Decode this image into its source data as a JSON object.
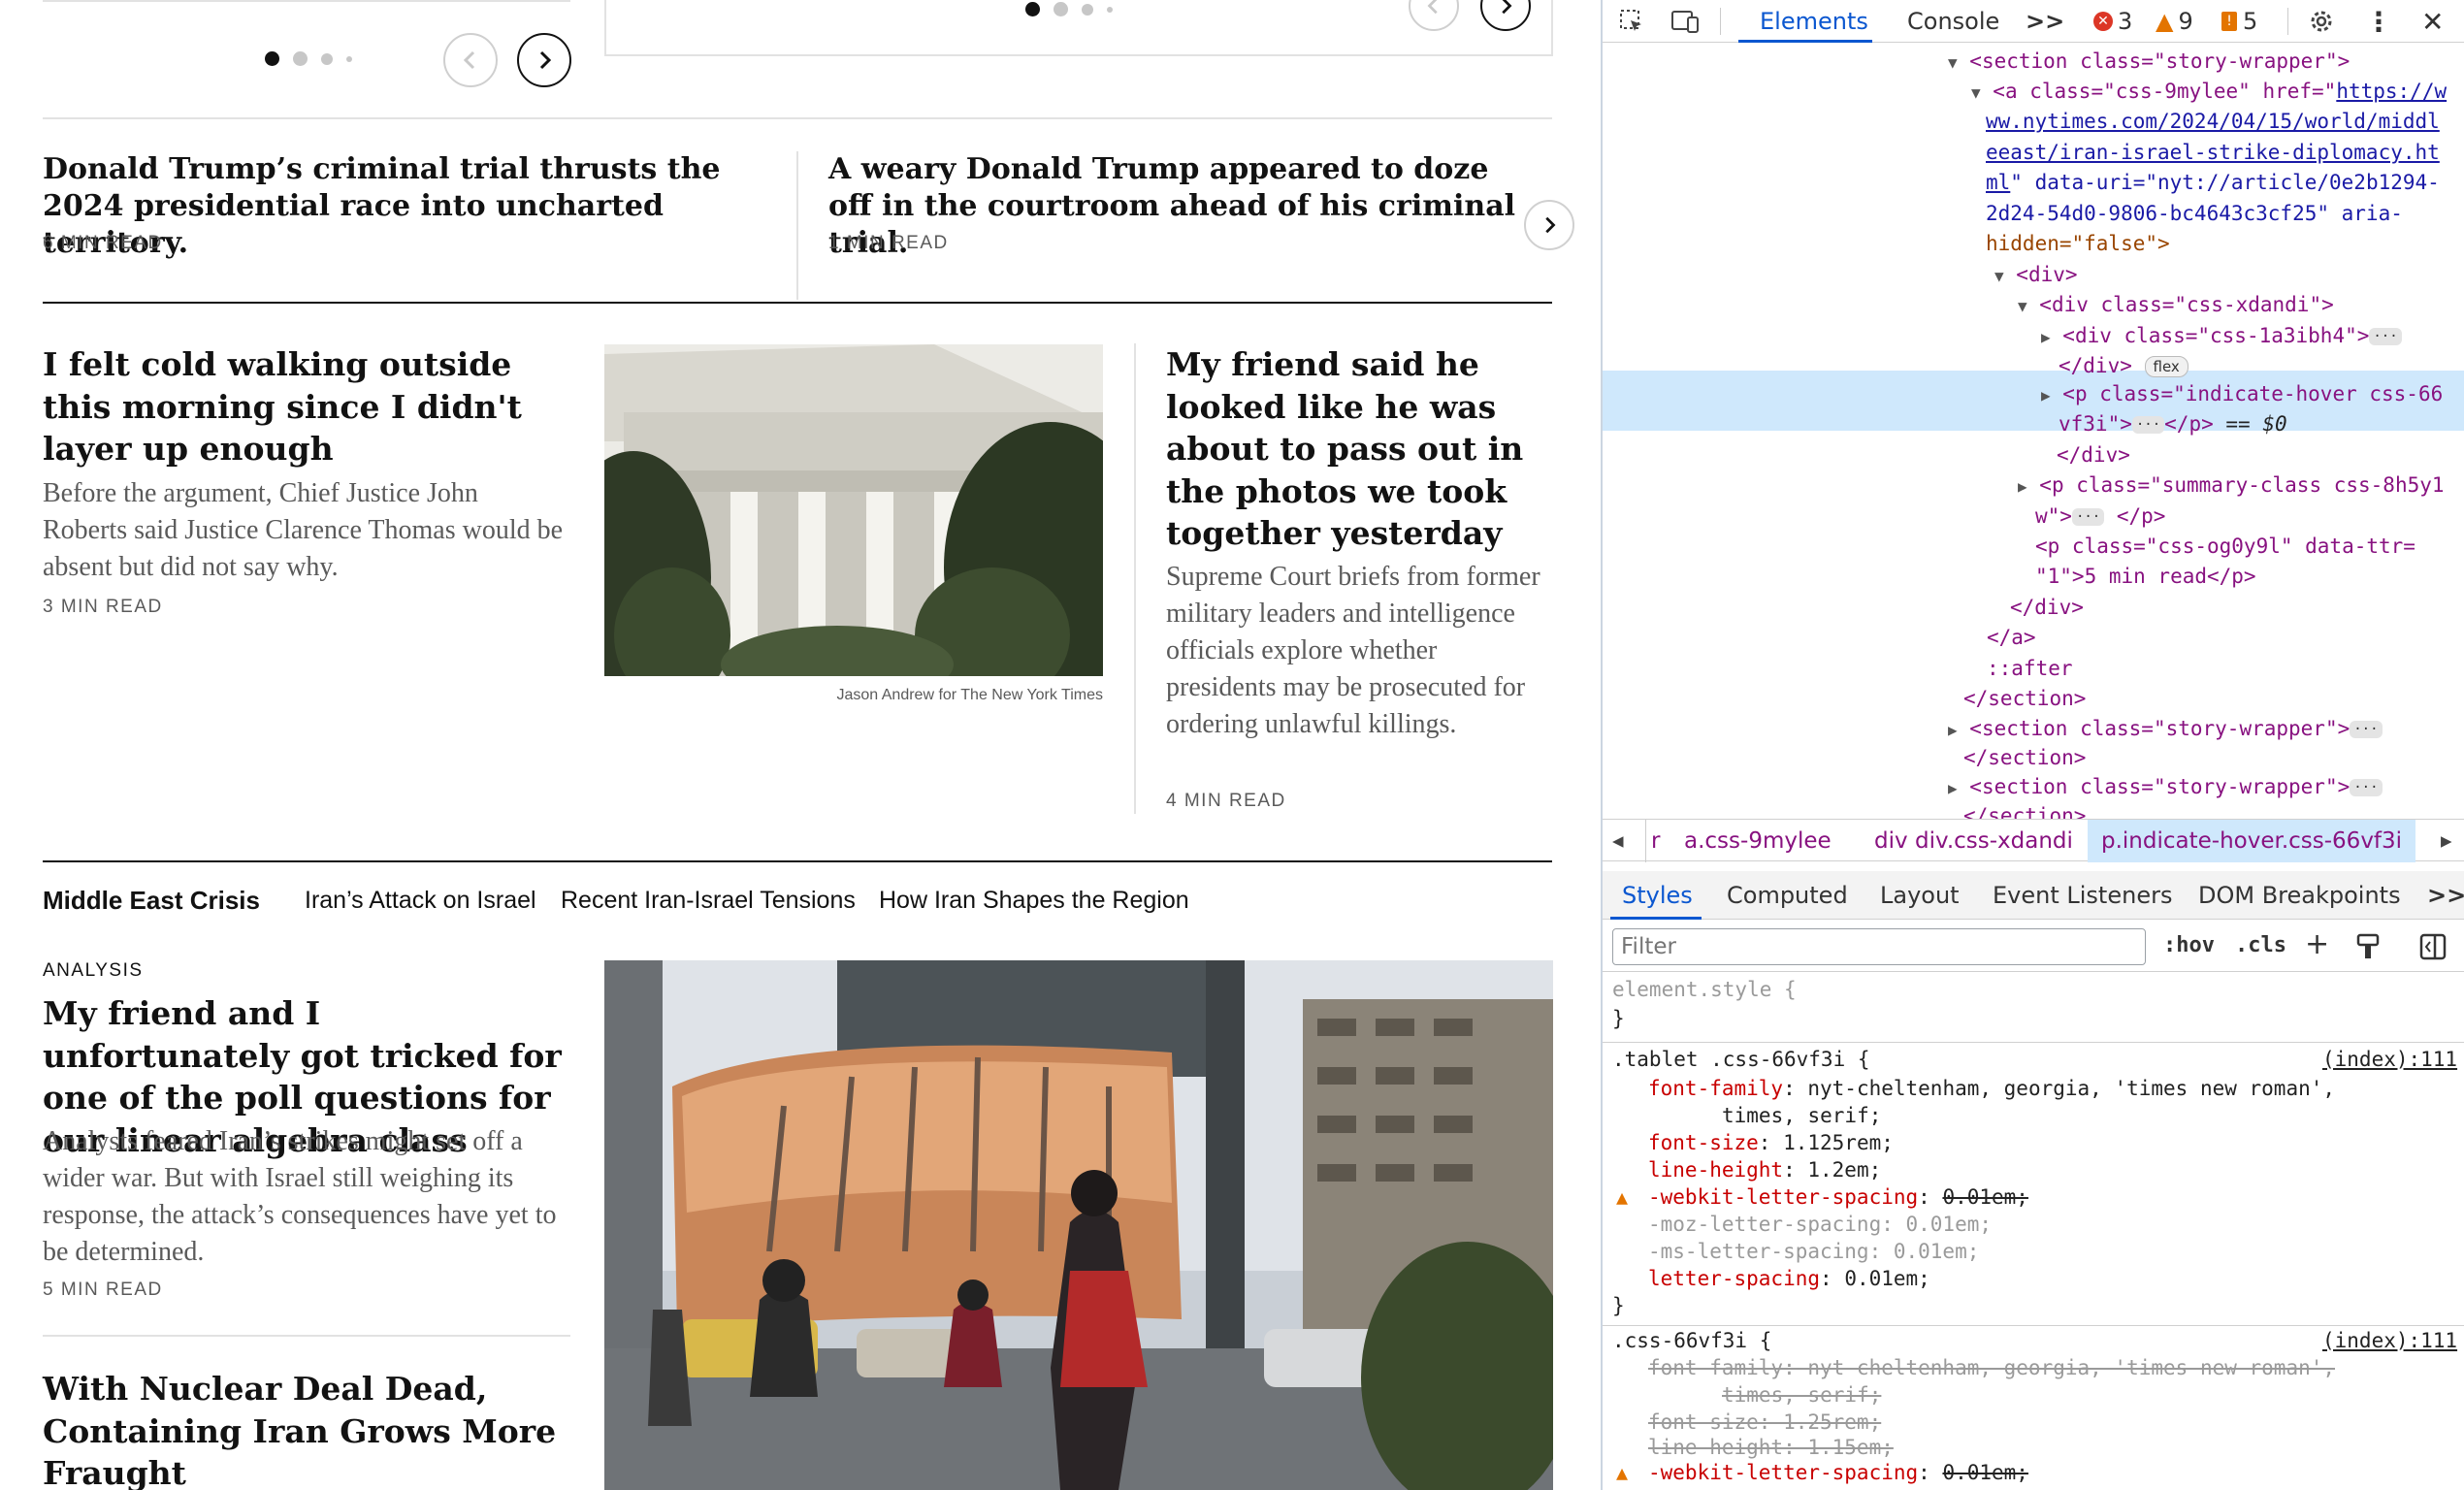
{
  "top_carousel_left": {
    "dots": 4,
    "active": 0
  },
  "top_carousel_right": {
    "dots": 4,
    "active": 0
  },
  "row1": [
    {
      "headline": "Donald Trump’s criminal trial thrusts the 2024 presidential race into uncharted territory.",
      "minread": "6 MIN READ"
    },
    {
      "headline": "A weary Donald Trump appeared to doze off in the courtroom ahead of his criminal trial.",
      "minread": "1 MIN READ"
    }
  ],
  "row2": {
    "left": {
      "headline": "I felt cold walking outside this morning since I didn't layer up enough",
      "summary": "Before the argument, Chief Justice John Roberts said Justice Clarence Thomas would be absent but did not say why.",
      "minread": "3 MIN READ"
    },
    "photo_credit": "Jason Andrew for The New York Times",
    "right": {
      "headline": "My friend said he looked like he was about to pass out in the photos we took together yesterday",
      "summary": "Supreme Court briefs from former military leaders and intelligence officials explore whether presidents may be prosecuted for ordering unlawful killings.",
      "minread": "4 MIN READ"
    }
  },
  "section_nav": {
    "title": "Middle East Crisis",
    "links": [
      "Iran’s Attack on Israel",
      "Recent Iran-Israel Tensions",
      "How Iran Shapes the Region"
    ]
  },
  "row3": {
    "kicker": "ANALYSIS",
    "headline": "My friend and I unfortunately got tricked for one of the poll questions for our linear algebra class",
    "summary": "Analysts feared Iran’s strikes might set off a wider war. But with Israel still weighing its response, the attack’s consequences have yet to be determined.",
    "minread": "5 MIN READ",
    "next_headline": "With Nuclear Deal Dead, Containing Iran Grows More Fraught"
  },
  "devtools": {
    "tabs": [
      "Elements",
      "Console"
    ],
    "more": ">>",
    "errors": "3",
    "warnings": "9",
    "issues": "5",
    "crumbs": [
      "r",
      "a.css-9mylee",
      "div",
      "div.css-xdandi",
      "p.indicate-hover.css-66vf3i"
    ],
    "subtabs": [
      "Styles",
      "Computed",
      "Layout",
      "Event Listeners",
      "DOM Breakpoints"
    ],
    "filter_placeholder": "Filter",
    "hov": ":hov",
    "cls": ".cls",
    "dom": {
      "l1": "<section class=\"story-wrapper\">",
      "a_open": "<a class=\"css-9mylee\" href=\"",
      "href1": "https://w",
      "href2": "ww.nytimes.com/2024/04/15/world/middl",
      "href3": "eeast/iran-israel-strike-diplomacy.ht",
      "href4": "ml",
      "data_uri": "\" data-uri=\"nyt://article/0e2b1294-",
      "data_uri2": "2d24-54d0-9806-bc4643c3cf25\" aria-",
      "hidden": "hidden=\"false\">",
      "div": "<div>",
      "div_x": "<div class=\"css-xdandi\">",
      "div_1a": "<div class=\"css-1a3ibh4\">",
      "close_div_flex": "</div>",
      "flex": "flex",
      "p_sel1": "<p class=\"indicate-hover css-66",
      "p_sel2": "vf3i\">",
      "p_sel_end": "</p>",
      "eq0": "== $0",
      "close_div": "</div>",
      "p_sum1": "<p class=\"summary-class css-8h5y1",
      "p_sum2": "w\">",
      "p_og": "<p class=\"css-og0y9l\" data-ttr=",
      "p_og2": "\"1\">5 min read</p>",
      "close_div2": "</div>",
      "close_a": "</a>",
      "after": "::after",
      "close_section": "</section>",
      "section2": "<section class=\"story-wrapper\">",
      "close_section2": "</section>",
      "section3": "<section class=\"story-wrapper\">",
      "close_section3": "</section>"
    },
    "styles": {
      "element_style": "element.style {",
      "close": "}",
      "rule1_sel": ".tablet .css-66vf3i {",
      "rule1_src": "(index):111",
      "r1_ff_prop": "font-family",
      "r1_ff_val": "nyt-cheltenham, georgia, 'times new roman',",
      "r1_ff_val2": "times, serif;",
      "r1_fs_prop": "font-size",
      "r1_fs_val": "1.125rem;",
      "r1_lh_prop": "line-height",
      "r1_lh_val": "1.2em;",
      "r1_wls_prop": "-webkit-letter-spacing",
      "r1_wls_val": "0.01em;",
      "r1_mls": "-moz-letter-spacing: 0.01em;",
      "r1_msls": "-ms-letter-spacing: 0.01em;",
      "r1_ls_prop": "letter-spacing",
      "r1_ls_val": "0.01em;",
      "rule2_sel": ".css-66vf3i {",
      "rule2_src": "(index):111",
      "r2_ff": "font-family: nyt-cheltenham, georgia, 'times new roman',",
      "r2_ff2": "times, serif;",
      "r2_fs": "font-size: 1.25rem;",
      "r2_lh": "line-height: 1.15em;",
      "r2_wls_prop": "-webkit-letter-spacing",
      "r2_wls_val": "0.01em;"
    }
  }
}
